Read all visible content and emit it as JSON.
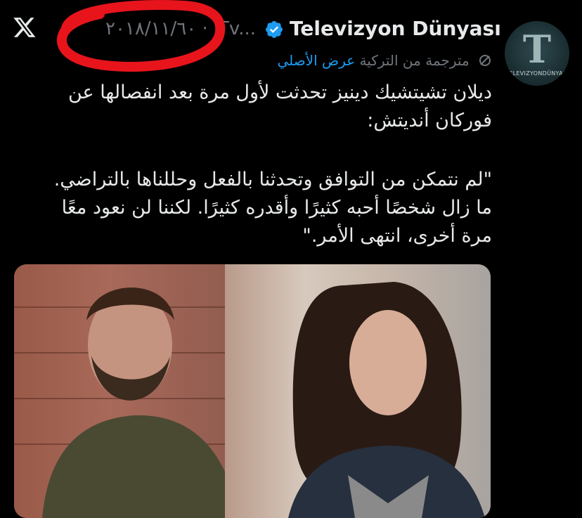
{
  "header": {
    "date": "٢٠١٨/١١/٦٠ ·",
    "handle_truncated": "Tv...",
    "account_name": "Televizyon Dünyası",
    "avatar_letter": "T",
    "avatar_caption": "TELEVIZYONDÜNYASI"
  },
  "translation": {
    "label": "مترجمة من التركية",
    "show_original": "عرض الأصلي"
  },
  "tweet": {
    "paragraph1": [
      "ديلان تشيتشيك دينيز تحدثت لأول مرة بعد انفصالها عن",
      "فوركان أنديتش:"
    ],
    "paragraph2": [
      "\"لم نتمكن من التوافق وتحدثنا بالفعل وحللناها بالتراضي.",
      "ما زال شخصًا أحبه كثيرًا وأقدره كثيرًا. لكننا لن نعود معًا",
      "مرة أخرى، انتهى الأمر.\""
    ]
  },
  "colors": {
    "background": "#000000",
    "text": "#e7e9ea",
    "muted": "#71767b",
    "link": "#1d9bf0",
    "verified": "#1d9bf0",
    "annotation_red": "#e8141c"
  },
  "icons": {
    "x_logo": "x-logo-icon",
    "verified": "verified-badge-icon",
    "translate": "translate-icon"
  }
}
